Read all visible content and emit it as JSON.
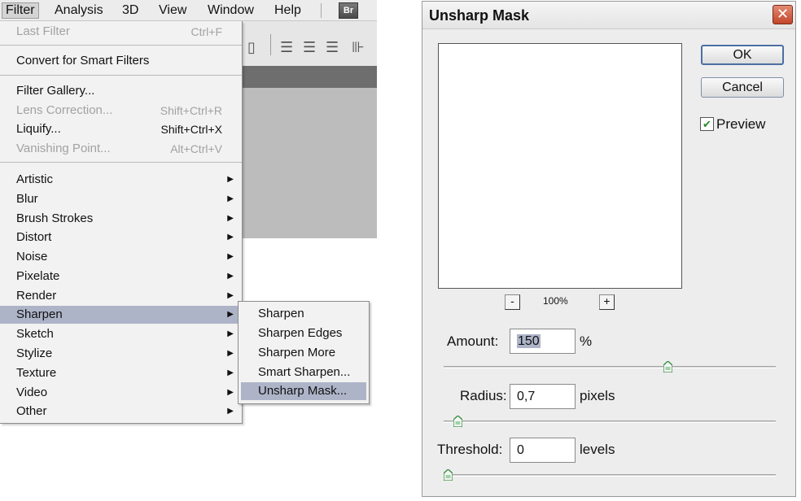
{
  "menubar": {
    "items": [
      {
        "label": "Filter",
        "active": true
      },
      {
        "label": "Analysis"
      },
      {
        "label": "3D"
      },
      {
        "label": "View"
      },
      {
        "label": "Window"
      },
      {
        "label": "Help"
      }
    ],
    "br_label": "Br"
  },
  "filter_menu": {
    "last_filter": {
      "label": "Last Filter",
      "shortcut": "Ctrl+F"
    },
    "convert": {
      "label": "Convert for Smart Filters"
    },
    "gallery": {
      "label": "Filter Gallery..."
    },
    "lens": {
      "label": "Lens Correction...",
      "shortcut": "Shift+Ctrl+R"
    },
    "liquify": {
      "label": "Liquify...",
      "shortcut": "Shift+Ctrl+X"
    },
    "vanishing": {
      "label": "Vanishing Point...",
      "shortcut": "Alt+Ctrl+V"
    },
    "groups": [
      "Artistic",
      "Blur",
      "Brush Strokes",
      "Distort",
      "Noise",
      "Pixelate",
      "Render",
      "Sharpen",
      "Sketch",
      "Stylize",
      "Texture",
      "Video",
      "Other"
    ],
    "highlighted": "Sharpen"
  },
  "sharpen_submenu": {
    "items": [
      "Sharpen",
      "Sharpen Edges",
      "Sharpen More",
      "Smart Sharpen...",
      "Unsharp Mask..."
    ],
    "highlighted": "Unsharp Mask..."
  },
  "dialog": {
    "title": "Unsharp Mask",
    "close": "✕",
    "ok": "OK",
    "cancel": "Cancel",
    "preview_label": "Preview",
    "preview_checked": true,
    "zoom_out": "-",
    "zoom_in": "+",
    "zoom": "100%",
    "amount": {
      "label": "Amount:",
      "value": "150",
      "unit": "%",
      "slider_fraction": 0.68
    },
    "radius": {
      "label": "Radius:",
      "value": "0,7",
      "unit": "pixels",
      "slider_fraction": 0.03
    },
    "threshold": {
      "label": "Threshold:",
      "value": "0",
      "unit": "levels",
      "slider_fraction": 0.0
    }
  },
  "colors": {
    "highlight": "#aeb4c8",
    "menu_bg": "#f2f2f2",
    "dialog_bg": "#ededed",
    "close_red": "#c3452a"
  }
}
